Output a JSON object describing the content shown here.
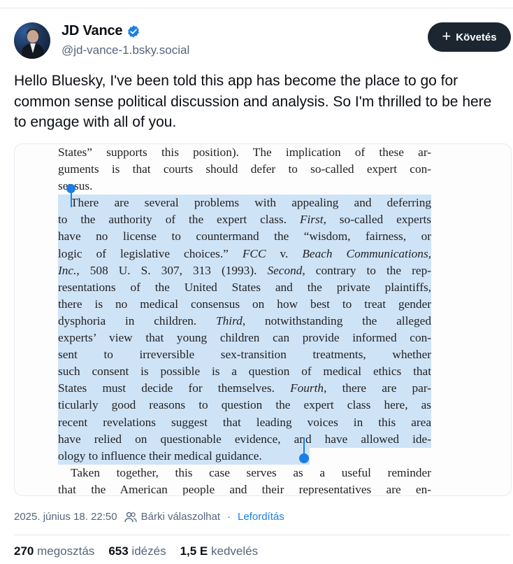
{
  "author": {
    "name": "JD Vance",
    "handle": "@jd-vance-1.bsky.social",
    "verified": true
  },
  "follow_button": {
    "label": "Követés",
    "icon": "plus-icon"
  },
  "post": {
    "text": "Hello Bluesky, I've been told this app has become the place to go for common sense political discussion and analysis. So I'm thrilled to be here to engage with all of you."
  },
  "embedded_document": {
    "lines": [
      "States” supports this position). The implication of these ar-",
      "guments is that courts should defer to so-called expert con-",
      "sensus.",
      "There are several problems with appealing and deferring",
      "to the authority of the expert class. First, so-called experts",
      "have no license to countermand the “wisdom, fairness, or",
      "logic of legislative choices.” FCC v. Beach Communications,",
      "Inc., 508 U. S. 307, 313 (1993). Second, contrary to the rep-",
      "resentations of the United States and the private plaintiffs,",
      "there is no medical consensus on how best to treat gender",
      "dysphoria in children. Third, notwithstanding the alleged",
      "experts’ view that young children can provide informed con-",
      "sent to irreversible sex-transition treatments, whether",
      "such consent is possible is a question of medical ethics that",
      "States must decide for themselves. Fourth, there are par-",
      "ticularly good reasons to question the expert class here, as",
      "recent revelations suggest that leading voices in this area",
      "have relied on questionable evidence, and have allowed ide-",
      "ology to influence their medical guidance.",
      "Taken together, this case serves as a useful reminder",
      "that the American people and their representatives are en-"
    ]
  },
  "meta": {
    "timestamp": "2025. június 18. 22:50",
    "reply_setting": "Bárki válaszolhat",
    "separator": "·",
    "translate_label": "Lefordítás"
  },
  "stats": {
    "reposts_count": "270",
    "reposts_label": "megosztás",
    "quotes_count": "653",
    "quotes_label": "idézés",
    "likes_count": "1,5 E",
    "likes_label": "kedvelés"
  },
  "colors": {
    "accent": "#1a7ee6",
    "follow_bg": "#1b2631",
    "highlight": "#cfe3f7",
    "muted_text": "#55667a"
  }
}
